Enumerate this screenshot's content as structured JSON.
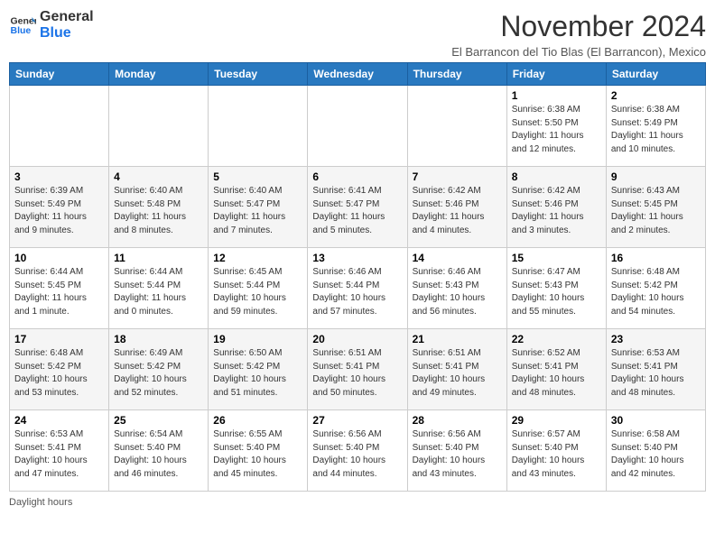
{
  "header": {
    "logo_general": "General",
    "logo_blue": "Blue",
    "title": "November 2024",
    "subtitle": "El Barrancon del Tio Blas (El Barrancon), Mexico"
  },
  "columns": [
    "Sunday",
    "Monday",
    "Tuesday",
    "Wednesday",
    "Thursday",
    "Friday",
    "Saturday"
  ],
  "weeks": [
    [
      {
        "day": "",
        "info": ""
      },
      {
        "day": "",
        "info": ""
      },
      {
        "day": "",
        "info": ""
      },
      {
        "day": "",
        "info": ""
      },
      {
        "day": "",
        "info": ""
      },
      {
        "day": "1",
        "info": "Sunrise: 6:38 AM\nSunset: 5:50 PM\nDaylight: 11 hours and 12 minutes."
      },
      {
        "day": "2",
        "info": "Sunrise: 6:38 AM\nSunset: 5:49 PM\nDaylight: 11 hours and 10 minutes."
      }
    ],
    [
      {
        "day": "3",
        "info": "Sunrise: 6:39 AM\nSunset: 5:49 PM\nDaylight: 11 hours and 9 minutes."
      },
      {
        "day": "4",
        "info": "Sunrise: 6:40 AM\nSunset: 5:48 PM\nDaylight: 11 hours and 8 minutes."
      },
      {
        "day": "5",
        "info": "Sunrise: 6:40 AM\nSunset: 5:47 PM\nDaylight: 11 hours and 7 minutes."
      },
      {
        "day": "6",
        "info": "Sunrise: 6:41 AM\nSunset: 5:47 PM\nDaylight: 11 hours and 5 minutes."
      },
      {
        "day": "7",
        "info": "Sunrise: 6:42 AM\nSunset: 5:46 PM\nDaylight: 11 hours and 4 minutes."
      },
      {
        "day": "8",
        "info": "Sunrise: 6:42 AM\nSunset: 5:46 PM\nDaylight: 11 hours and 3 minutes."
      },
      {
        "day": "9",
        "info": "Sunrise: 6:43 AM\nSunset: 5:45 PM\nDaylight: 11 hours and 2 minutes."
      }
    ],
    [
      {
        "day": "10",
        "info": "Sunrise: 6:44 AM\nSunset: 5:45 PM\nDaylight: 11 hours and 1 minute."
      },
      {
        "day": "11",
        "info": "Sunrise: 6:44 AM\nSunset: 5:44 PM\nDaylight: 11 hours and 0 minutes."
      },
      {
        "day": "12",
        "info": "Sunrise: 6:45 AM\nSunset: 5:44 PM\nDaylight: 10 hours and 59 minutes."
      },
      {
        "day": "13",
        "info": "Sunrise: 6:46 AM\nSunset: 5:44 PM\nDaylight: 10 hours and 57 minutes."
      },
      {
        "day": "14",
        "info": "Sunrise: 6:46 AM\nSunset: 5:43 PM\nDaylight: 10 hours and 56 minutes."
      },
      {
        "day": "15",
        "info": "Sunrise: 6:47 AM\nSunset: 5:43 PM\nDaylight: 10 hours and 55 minutes."
      },
      {
        "day": "16",
        "info": "Sunrise: 6:48 AM\nSunset: 5:42 PM\nDaylight: 10 hours and 54 minutes."
      }
    ],
    [
      {
        "day": "17",
        "info": "Sunrise: 6:48 AM\nSunset: 5:42 PM\nDaylight: 10 hours and 53 minutes."
      },
      {
        "day": "18",
        "info": "Sunrise: 6:49 AM\nSunset: 5:42 PM\nDaylight: 10 hours and 52 minutes."
      },
      {
        "day": "19",
        "info": "Sunrise: 6:50 AM\nSunset: 5:42 PM\nDaylight: 10 hours and 51 minutes."
      },
      {
        "day": "20",
        "info": "Sunrise: 6:51 AM\nSunset: 5:41 PM\nDaylight: 10 hours and 50 minutes."
      },
      {
        "day": "21",
        "info": "Sunrise: 6:51 AM\nSunset: 5:41 PM\nDaylight: 10 hours and 49 minutes."
      },
      {
        "day": "22",
        "info": "Sunrise: 6:52 AM\nSunset: 5:41 PM\nDaylight: 10 hours and 48 minutes."
      },
      {
        "day": "23",
        "info": "Sunrise: 6:53 AM\nSunset: 5:41 PM\nDaylight: 10 hours and 48 minutes."
      }
    ],
    [
      {
        "day": "24",
        "info": "Sunrise: 6:53 AM\nSunset: 5:41 PM\nDaylight: 10 hours and 47 minutes."
      },
      {
        "day": "25",
        "info": "Sunrise: 6:54 AM\nSunset: 5:40 PM\nDaylight: 10 hours and 46 minutes."
      },
      {
        "day": "26",
        "info": "Sunrise: 6:55 AM\nSunset: 5:40 PM\nDaylight: 10 hours and 45 minutes."
      },
      {
        "day": "27",
        "info": "Sunrise: 6:56 AM\nSunset: 5:40 PM\nDaylight: 10 hours and 44 minutes."
      },
      {
        "day": "28",
        "info": "Sunrise: 6:56 AM\nSunset: 5:40 PM\nDaylight: 10 hours and 43 minutes."
      },
      {
        "day": "29",
        "info": "Sunrise: 6:57 AM\nSunset: 5:40 PM\nDaylight: 10 hours and 43 minutes."
      },
      {
        "day": "30",
        "info": "Sunrise: 6:58 AM\nSunset: 5:40 PM\nDaylight: 10 hours and 42 minutes."
      }
    ]
  ],
  "footer": {
    "daylight_label": "Daylight hours"
  }
}
